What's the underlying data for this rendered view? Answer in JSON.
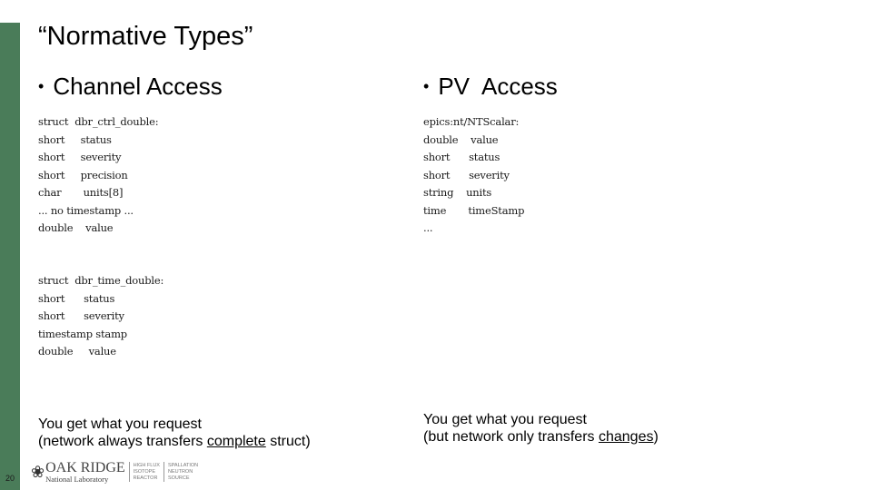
{
  "slide": {
    "number": "20",
    "title": "“Normative Types”"
  },
  "left": {
    "heading_bullet": "•",
    "heading": "Channel Access",
    "ctrl_struct": [
      "struct  dbr_ctrl_double:",
      "short     status",
      "short     severity",
      "short     precision",
      "char       units[8]",
      "... no timestamp ...",
      "double    value"
    ],
    "time_struct": [
      "struct  dbr_time_double:",
      "short      status",
      "short      severity",
      "timestamp stamp",
      "double     value"
    ],
    "summary_line1": "You get what you request",
    "summary_line2_pre": "(network always transfers ",
    "summary_line2_emph": "complete",
    "summary_line2_post": " struct)"
  },
  "right": {
    "heading_bullet": "•",
    "heading": "PV  Access",
    "struct": [
      "epics:nt/NTScalar:",
      "double    value",
      "short      status",
      "short      severity",
      "string    units",
      "time       timeStamp",
      "..."
    ],
    "summary_line1": "You get what you request",
    "summary_line2_pre": "(but network only transfers ",
    "summary_line2_emph": "changes",
    "summary_line2_post": ")"
  },
  "footer": {
    "logo_icon": "oak-leaf-icon",
    "logo_name": "OAK RIDGE",
    "logo_sub": "National Laboratory",
    "facility1": [
      "HIGH FLUX",
      "ISOTOPE",
      "REACTOR"
    ],
    "facility2": [
      "SPALLATION",
      "NEUTRON",
      "SOURCE"
    ]
  },
  "colors": {
    "accent_green": "#4a7c59"
  }
}
